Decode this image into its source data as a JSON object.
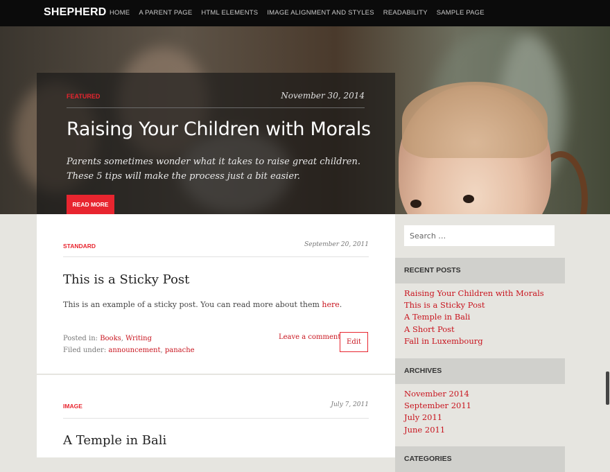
{
  "site": {
    "title": "SHEPHERD"
  },
  "nav": [
    {
      "label": "HOME"
    },
    {
      "label": "A PARENT PAGE"
    },
    {
      "label": "HTML ELEMENTS"
    },
    {
      "label": "IMAGE ALIGNMENT AND STYLES"
    },
    {
      "label": "READABILITY"
    },
    {
      "label": "SAMPLE PAGE"
    }
  ],
  "featured": {
    "category": "FEATURED",
    "date": "November 30, 2014",
    "title": "Raising Your Children with Morals",
    "excerpt": "Parents sometimes wonder what it takes to raise great children. These 5 tips will make the process just a bit easier.",
    "button": "READ MORE"
  },
  "posts": [
    {
      "category": "STANDARD",
      "date": "September 20, 2011",
      "title": "This is a Sticky Post",
      "excerpt": "This is an example of a sticky post. You can read more about them ",
      "excerpt_link": "here",
      "excerpt_end": ".",
      "posted_label": "Posted in: ",
      "posted_in": [
        "Books",
        "Writing"
      ],
      "filed_label": "Filed under: ",
      "filed_under": [
        "announcement",
        "panache"
      ],
      "comment": "Leave a comment",
      "edit": "Edit"
    },
    {
      "category": "IMAGE",
      "date": "July 7, 2011",
      "title": "A Temple in Bali"
    }
  ],
  "sidebar": {
    "search_placeholder": "Search …",
    "recent_title": "RECENT POSTS",
    "recent": [
      "Raising Your Children with Morals",
      "This is a Sticky Post",
      "A Temple in Bali",
      "A Short Post",
      "Fall in Luxembourg"
    ],
    "archives_title": "ARCHIVES",
    "archives": [
      "November 2014",
      "September 2011",
      "July 2011",
      "June 2011"
    ],
    "categories_title": "CATEGORIES"
  },
  "colors": {
    "accent": "#e8252f",
    "link": "#c8141e",
    "nav_bg": "#0b0b0b"
  }
}
